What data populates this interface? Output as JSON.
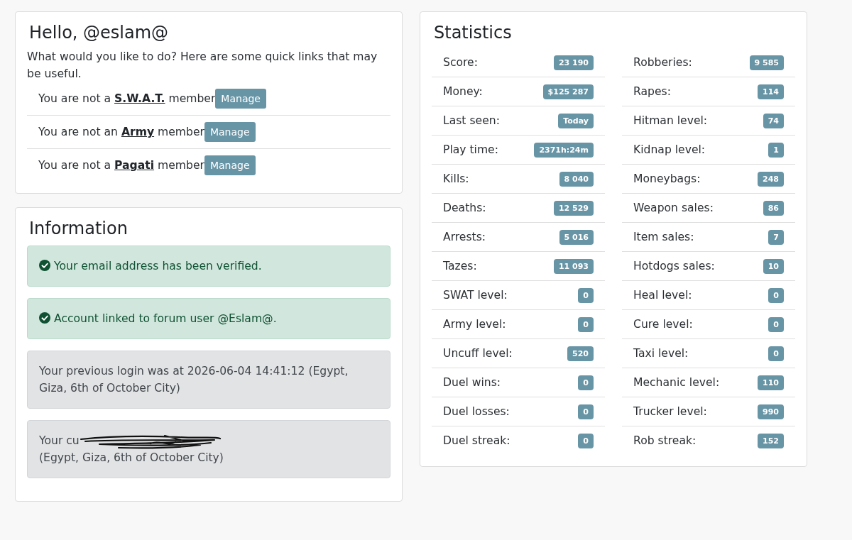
{
  "greeting_card": {
    "title": "Hello, @eslam@",
    "intro": "What would you like to do? Here are some quick links that may be useful.",
    "memberships": [
      {
        "text_before": "You are not a",
        "group": "S.W.A.T.",
        "text_after": "member",
        "button": "Manage"
      },
      {
        "text_before": "You are not an",
        "group": "Army",
        "text_after": "member",
        "button": "Manage"
      },
      {
        "text_before": "You are not a",
        "group": "Pagati",
        "text_after": "member",
        "button": "Manage"
      }
    ]
  },
  "information_card": {
    "title": "Information",
    "alerts": [
      {
        "kind": "success",
        "text": "Your email address has been verified.",
        "redacted": false
      },
      {
        "kind": "success",
        "text": "Account linked to forum user @Eslam@.",
        "redacted": false
      },
      {
        "kind": "secondary",
        "text": "Your previous login was at 2026-06-04 14:41:12 (Egypt, Giza, 6th of October City)",
        "redacted": false
      },
      {
        "kind": "secondary",
        "text": "Your cu",
        "redacted": true,
        "text_after": "(Egypt, Giza, 6th of October City)"
      }
    ]
  },
  "statistics_card": {
    "title": "Statistics",
    "columns": [
      {
        "rows": [
          {
            "label": "Score:",
            "value": "23 190"
          },
          {
            "label": "Money:",
            "value": "$125 287"
          },
          {
            "label": "Last seen:",
            "value": "Today"
          },
          {
            "label": "Play time:",
            "value": "2371h:24m"
          },
          {
            "label": "Kills:",
            "value": "8 040"
          },
          {
            "label": "Deaths:",
            "value": "12 529"
          },
          {
            "label": "Arrests:",
            "value": "5 016"
          },
          {
            "label": "Tazes:",
            "value": "11 093"
          },
          {
            "label": "SWAT level:",
            "value": "0"
          },
          {
            "label": "Army level:",
            "value": "0"
          },
          {
            "label": "Uncuff level:",
            "value": "520"
          },
          {
            "label": "Duel wins:",
            "value": "0"
          },
          {
            "label": "Duel losses:",
            "value": "0"
          },
          {
            "label": "Duel streak:",
            "value": "0"
          }
        ]
      },
      {
        "rows": [
          {
            "label": "Robberies:",
            "value": "9 585"
          },
          {
            "label": "Rapes:",
            "value": "114"
          },
          {
            "label": "Hitman level:",
            "value": "74"
          },
          {
            "label": "Kidnap level:",
            "value": "1"
          },
          {
            "label": "Moneybags:",
            "value": "248"
          },
          {
            "label": "Weapon sales:",
            "value": "86"
          },
          {
            "label": "Item sales:",
            "value": "7"
          },
          {
            "label": "Hotdogs sales:",
            "value": "10"
          },
          {
            "label": "Heal level:",
            "value": "0"
          },
          {
            "label": "Cure level:",
            "value": "0"
          },
          {
            "label": "Taxi level:",
            "value": "0"
          },
          {
            "label": "Mechanic level:",
            "value": "110"
          },
          {
            "label": "Trucker level:",
            "value": "990"
          },
          {
            "label": "Rob streak:",
            "value": "152"
          }
        ]
      }
    ]
  }
}
